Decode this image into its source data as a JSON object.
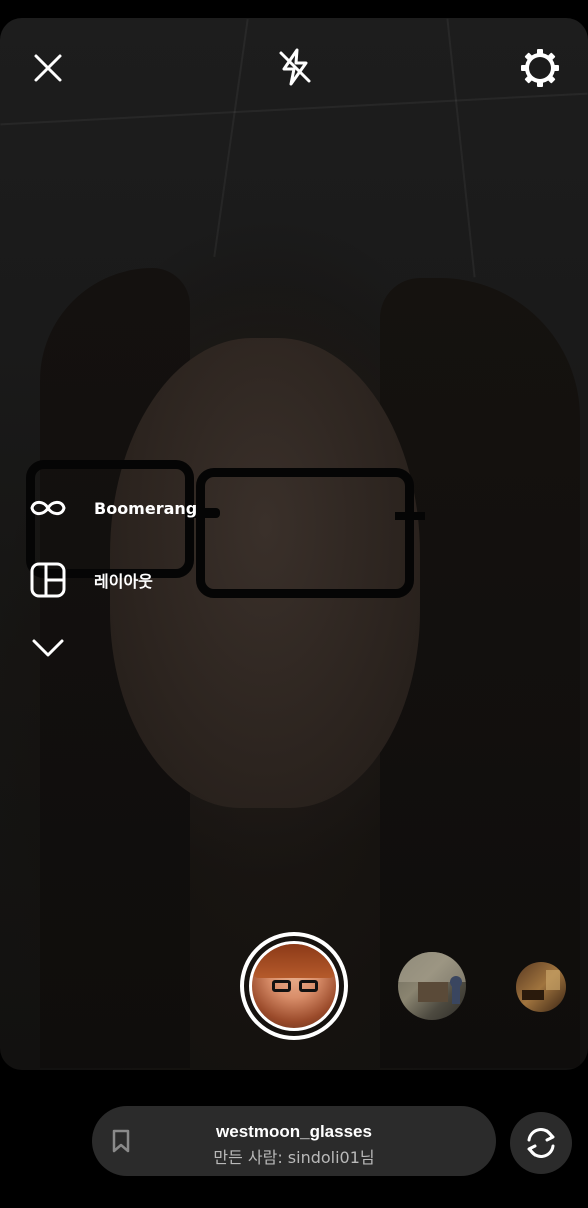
{
  "top_bar": {
    "close_icon": "close-icon",
    "flash_icon": "flash-off-icon",
    "settings_icon": "gear-icon"
  },
  "side_menu": {
    "items": [
      {
        "icon": "infinity-icon",
        "label": "Boomerang"
      },
      {
        "icon": "layout-icon",
        "label": "레이아웃"
      }
    ],
    "expand_icon": "chevron-down-icon"
  },
  "effects": {
    "selected_effect_icon": "face-glasses-preview",
    "thumbnails": [
      "effect-thumb-room",
      "effect-thumb-room-2"
    ]
  },
  "bottom": {
    "effect_name": "westmoon_glasses",
    "creator_text": "만든 사람: sindoli01님",
    "save_icon": "bookmark-icon",
    "flip_icon": "camera-flip-icon"
  },
  "colors": {
    "background": "#000000",
    "pill_background": "#2b2b2b",
    "text_primary": "#ffffff",
    "text_secondary": "#b9b9b9"
  }
}
